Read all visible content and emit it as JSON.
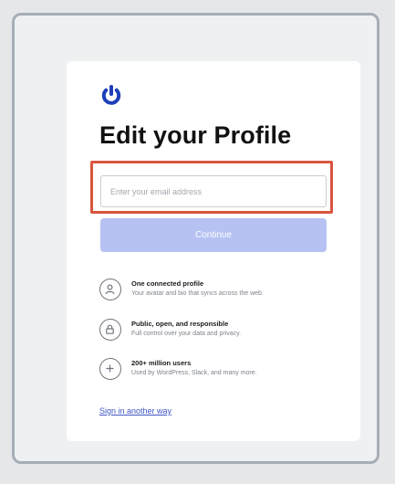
{
  "page": {
    "title": "Edit your Profile"
  },
  "form": {
    "email_placeholder": "Enter your email address",
    "email_value": "",
    "continue_label": "Continue"
  },
  "features": [
    {
      "icon": "user-icon",
      "title": "One connected profile",
      "description": "Your avatar and bio that syncs across the web."
    },
    {
      "icon": "lock-icon",
      "title": "Public, open, and responsible",
      "description": "Full control over your data and privacy."
    },
    {
      "icon": "plus-icon",
      "title": "200+ million users",
      "description": "Used by WordPress, Slack, and many more."
    }
  ],
  "links": {
    "signin_other": "Sign in another way"
  },
  "colors": {
    "brand": "#1d3fb8",
    "button": "#b6c2f2",
    "highlight": "#d9553e",
    "link": "#3f57c5"
  }
}
